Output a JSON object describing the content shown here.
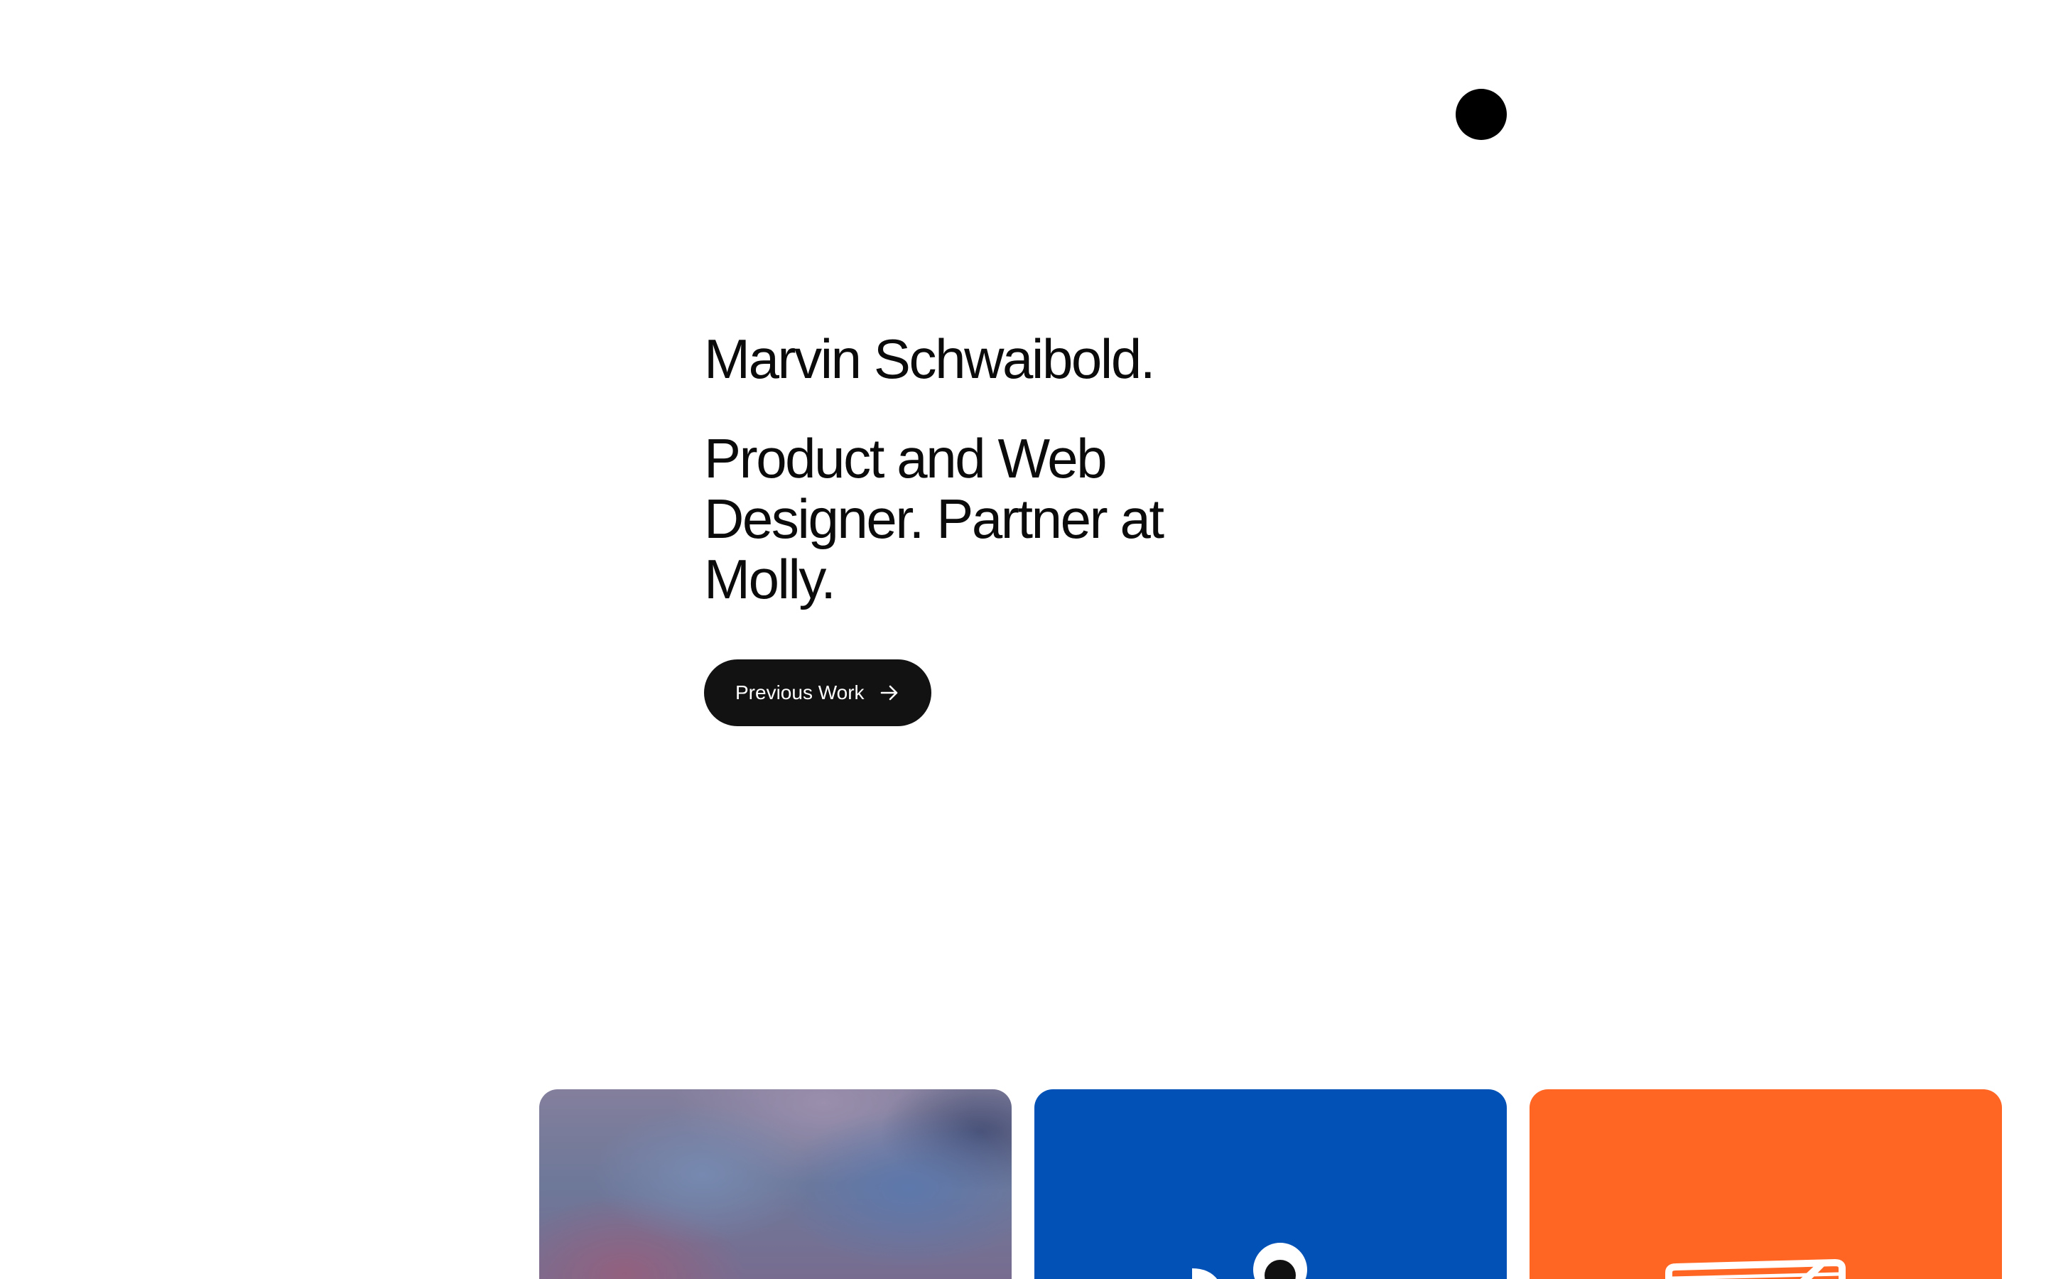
{
  "hero": {
    "name": "Marvin Schwaibold.",
    "tagline": "Product and Web Designer. Partner at Molly."
  },
  "cta": {
    "label": "Previous Work",
    "icon": "arrow-right-icon"
  },
  "decor": {
    "dot_icon": "black-dot"
  },
  "projects": [
    {
      "name": "project-card-blurred",
      "color": "#7a7a9a"
    },
    {
      "name": "project-card-blue",
      "color": "#0251b7"
    },
    {
      "name": "project-card-orange",
      "color": "#ff6623"
    }
  ],
  "colors": {
    "text": "#0b0b0b",
    "button_bg": "#121212",
    "button_text": "#ffffff",
    "blue": "#0251b7",
    "orange": "#ff6623"
  }
}
